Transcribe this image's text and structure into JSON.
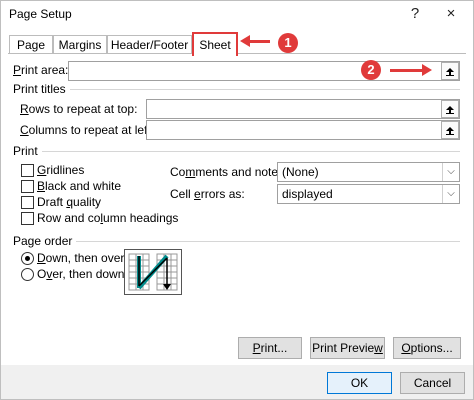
{
  "window": {
    "title": "Page Setup",
    "help_label": "?",
    "close_label": "×"
  },
  "tabs": [
    {
      "label": "Page",
      "active": false
    },
    {
      "label": "Margins",
      "active": false
    },
    {
      "label": "Header/Footer",
      "active": false
    },
    {
      "label": "Sheet",
      "active": true
    }
  ],
  "print_area": {
    "label": "Print area:",
    "value": "",
    "upload_icon": "collapse-dialog-icon"
  },
  "print_titles": {
    "group_label": "Print titles",
    "rows_label": "Rows to repeat at top:",
    "rows_value": "",
    "cols_label": "Columns to repeat at left:",
    "cols_value": ""
  },
  "print_options": {
    "group_label": "Print",
    "checkboxes": [
      {
        "label": "Gridlines",
        "checked": false
      },
      {
        "label": "Black and white",
        "checked": false
      },
      {
        "label": "Draft quality",
        "checked": false
      },
      {
        "label": "Row and column headings",
        "checked": false
      }
    ],
    "comments_label": "Comments and notes:",
    "comments_value": "(None)",
    "errors_label": "Cell errors as:",
    "errors_value": "displayed"
  },
  "page_order": {
    "group_label": "Page order",
    "options": [
      {
        "label": "Down, then over",
        "selected": true
      },
      {
        "label": "Over, then down",
        "selected": false
      }
    ]
  },
  "buttons": {
    "print": "Print...",
    "print_preview": "Print Preview",
    "options": "Options...",
    "ok": "OK",
    "cancel": "Cancel"
  },
  "annotations": {
    "marker1": "1",
    "marker2": "2",
    "color": "#e03a3a"
  }
}
